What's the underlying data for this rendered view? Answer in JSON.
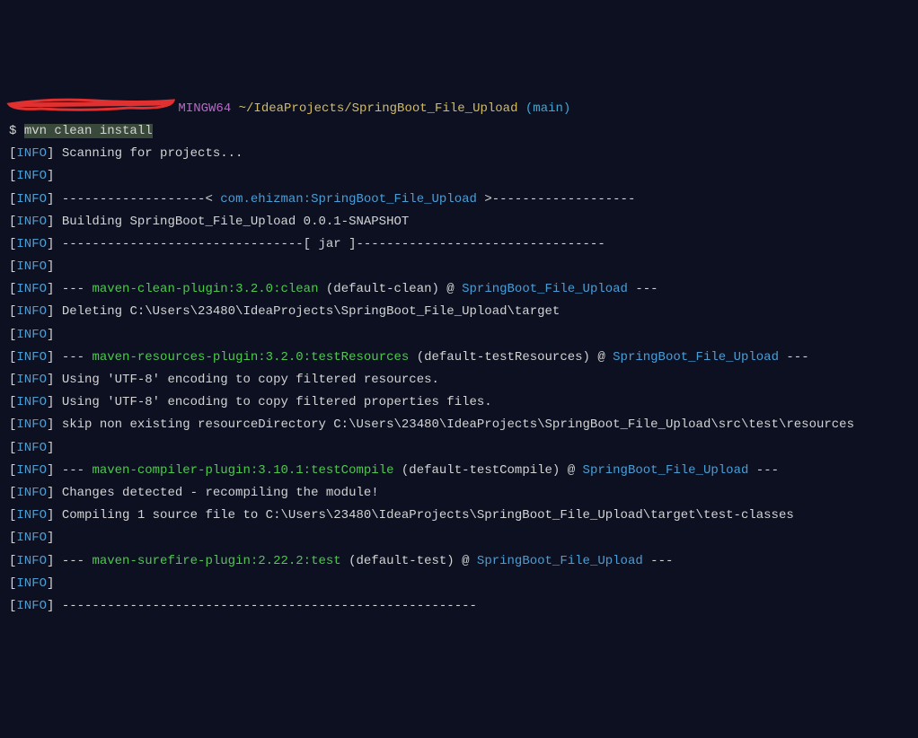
{
  "prompt": {
    "mingw": "MINGW64",
    "path": "~/IdeaProjects/SpringBoot_File_Upload",
    "branch_open": "(",
    "branch": "main",
    "branch_close": ")",
    "dollar": "$ ",
    "command": "mvn clean install"
  },
  "info_label": "INFO",
  "lines": {
    "l1": "Scanning for projects...",
    "l2": "",
    "l3a": "-------------------< ",
    "l3b": "com.ehizman:SpringBoot_File_Upload",
    "l3c": " >-------------------",
    "l4": "Building SpringBoot_File_Upload 0.0.1-SNAPSHOT",
    "l5": "--------------------------------[ jar ]---------------------------------",
    "l6": "",
    "l7a": "--- ",
    "l7b": "maven-clean-plugin:3.2.0:clean",
    "l7c": " (default-clean) @ ",
    "l7d": "SpringBoot_File_Upload",
    "l7e": " ---",
    "l8": "Deleting C:\\Users\\23480\\IdeaProjects\\SpringBoot_File_Upload\\target",
    "l9": "",
    "l10a": "--- ",
    "l10b": "maven-resources-plugin:3.2.0:testResources",
    "l10c": " (default-testResources) @ ",
    "l10d": "SpringBoot_File_Upload",
    "l10e": " ---",
    "l11": "Using 'UTF-8' encoding to copy filtered resources.",
    "l12": "Using 'UTF-8' encoding to copy filtered properties files.",
    "l13": "skip non existing resourceDirectory C:\\Users\\23480\\IdeaProjects\\SpringBoot_File_Upload\\src\\test\\resources",
    "l14": "",
    "l15a": "--- ",
    "l15b": "maven-compiler-plugin:3.10.1:testCompile",
    "l15c": " (default-testCompile) @ ",
    "l15d": "SpringBoot_File_Upload",
    "l15e": " ---",
    "l16": "Changes detected - recompiling the module!",
    "l17": "Compiling 1 source file to C:\\Users\\23480\\IdeaProjects\\SpringBoot_File_Upload\\target\\test-classes",
    "l18": "",
    "l19a": "--- ",
    "l19b": "maven-surefire-plugin:2.22.2:test",
    "l19c": " (default-test) @ ",
    "l19d": "SpringBoot_File_Upload",
    "l19e": " ---",
    "l20": "",
    "l21": "-------------------------------------------------------"
  }
}
